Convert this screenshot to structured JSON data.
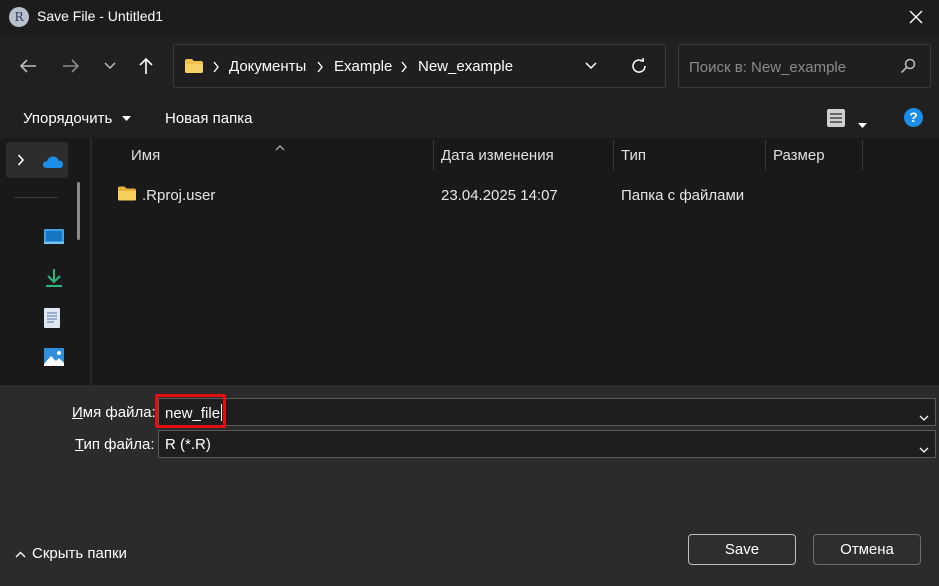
{
  "window": {
    "title": "Save File - Untitled1",
    "app_icon_letter": "R"
  },
  "addressbar": {
    "crumbs": [
      "Документы",
      "Example",
      "New_example"
    ]
  },
  "search": {
    "placeholder": "Поиск в: New_example"
  },
  "toolbar": {
    "organize_label": "Упорядочить",
    "new_folder_label": "Новая папка"
  },
  "columns": {
    "name": "Имя",
    "date": "Дата изменения",
    "type": "Тип",
    "size": "Размер"
  },
  "files": [
    {
      "name": ".Rproj.user",
      "date": "23.04.2025 14:07",
      "type": "Папка с файлами",
      "size": ""
    }
  ],
  "filename": {
    "label_prefix": "",
    "label_underlined": "И",
    "label_rest": "мя файла:",
    "value": "new_file"
  },
  "filetype": {
    "label_underlined": "Т",
    "label_rest": "ип файла:",
    "value": "R (*.R)"
  },
  "footer": {
    "hide_folders_label": "Скрыть папки",
    "save_label": "Save",
    "cancel_label": "Отмена"
  },
  "colors": {
    "accent": "#1a8ee8",
    "highlight": "#e01010",
    "folder": "#f2c14e"
  }
}
